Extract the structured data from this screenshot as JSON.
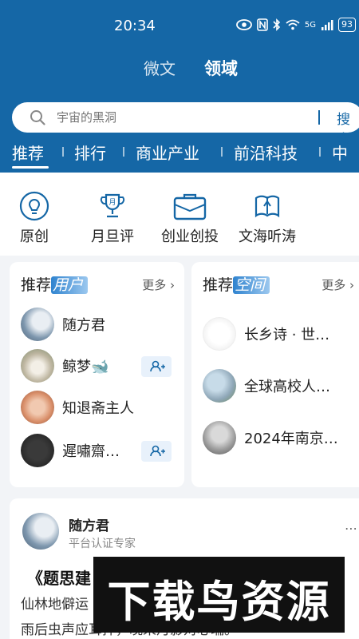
{
  "status_bar": {
    "time": "20:34",
    "icons": [
      "eye-icon",
      "nfc-icon",
      "bluetooth-icon",
      "wifi-icon",
      "signal-icon"
    ],
    "network": "5G",
    "battery": "93"
  },
  "top_tabs": [
    {
      "label": "微文",
      "active": false
    },
    {
      "label": "领域",
      "active": true
    }
  ],
  "search": {
    "placeholder": "宇宙的黑洞",
    "button": "搜索"
  },
  "categories": [
    "推荐",
    "排行",
    "商业产业",
    "前沿科技",
    "中"
  ],
  "quick_links": [
    {
      "label": "原创",
      "icon": "bulb-icon"
    },
    {
      "label": "月旦评",
      "icon": "trophy-icon"
    },
    {
      "label": "创业创投",
      "icon": "briefcase-icon"
    },
    {
      "label": "文海听涛",
      "icon": "book-icon"
    }
  ],
  "recommended_users": {
    "title_prefix": "推荐",
    "title_highlight": "用户",
    "more": "更多",
    "items": [
      {
        "name": "随方君",
        "follow": false
      },
      {
        "name": "鲸梦🐋",
        "follow": true
      },
      {
        "name": "知退斋主人",
        "follow": false
      },
      {
        "name": "遲嘯齋…",
        "follow": true
      }
    ]
  },
  "recommended_spaces": {
    "title_prefix": "推荐",
    "title_highlight": "空间",
    "more": "更多",
    "items": [
      {
        "name": "长乡诗 · 世…"
      },
      {
        "name": "全球高校人…"
      },
      {
        "name": "2024年南京…"
      }
    ]
  },
  "post": {
    "author": "随方君",
    "role": "平台认证专家",
    "title": "《题思建",
    "lines": [
      "仙林地僻运",
      "雨后虫声应耳拌，晚来月影对心瑞。"
    ]
  },
  "watermark": "下载鸟资源",
  "colors": {
    "brand": "#1567a6",
    "accent_light": "#e8f1fb"
  }
}
